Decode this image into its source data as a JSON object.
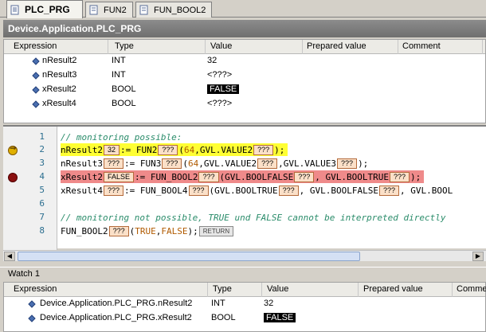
{
  "tabs": [
    {
      "label": "PLC_PRG",
      "active": true
    },
    {
      "label": "FUN2",
      "active": false
    },
    {
      "label": "FUN_BOOL2",
      "active": false
    }
  ],
  "object_title": "Device.Application.PLC_PRG",
  "grid": {
    "columns": [
      "Expression",
      "Type",
      "Value",
      "Prepared value",
      "Comment"
    ],
    "rows": [
      {
        "expr": "nResult2",
        "type": "INT",
        "value": "32"
      },
      {
        "expr": "nResult3",
        "type": "INT",
        "value": "<???>"
      },
      {
        "expr": "xResult2",
        "type": "BOOL",
        "value": "FALSE"
      },
      {
        "expr": "xResult4",
        "type": "BOOL",
        "value": "<???>"
      }
    ]
  },
  "code": {
    "line_numbers": [
      "1",
      "2",
      "3",
      "4",
      "5",
      "6",
      "7",
      "8"
    ],
    "l1": "// monitoring possible:",
    "l2": {
      "a": "nResult2",
      "m1": "32",
      "b": " := FUN2",
      "m2": "???",
      "c": "(",
      "lit": "64",
      "d": ",GVL.VALUE2",
      "m3": "???",
      "e": ");"
    },
    "l3": {
      "a": "nResult3",
      "m1": "???",
      "b": " := FUN3",
      "m2": "???",
      "c": "(",
      "lit": "64",
      "d": ",GVL.VALUE2",
      "m3": "???",
      "e": ",GVL.VALUE3",
      "m4": "???",
      "f": ");"
    },
    "l4": {
      "a": "xResult2",
      "m1": "FALSE",
      "b": " := FUN_BOOL2",
      "m2": "???",
      "c": "(GVL.BOOLFALSE",
      "m3": "???",
      "d": ", GVL.BOOLTRUE",
      "m4": "???",
      "e": ");"
    },
    "l5": {
      "a": "xResult4",
      "m1": "???",
      "b": " := FUN_BOOL4",
      "m2": "???",
      "c": "(GVL.BOOLTRUE",
      "m3": "???",
      "d": ", GVL.BOOLFALSE",
      "m4": "???",
      "e": ", GVL.BOOL"
    },
    "l7": "// monitoring not possible, TRUE und FALSE cannot be interpreted directly",
    "l8": {
      "a": "FUN_BOOL2",
      "m1": "???",
      "b": "(",
      "lit1": "TRUE",
      "c": ", ",
      "lit2": "FALSE",
      "d": ");",
      "m2": "RETURN"
    }
  },
  "watch": {
    "title": "Watch 1",
    "columns": [
      "Expression",
      "Type",
      "Value",
      "Prepared value",
      "Comme"
    ],
    "rows": [
      {
        "expr": "Device.Application.PLC_PRG.nResult2",
        "type": "INT",
        "value": "32"
      },
      {
        "expr": "Device.Application.PLC_PRG.xResult2",
        "type": "BOOL",
        "value": "FALSE"
      }
    ]
  },
  "colors": {
    "highlight_current": "#ffff33",
    "highlight_breakpoint": "#ef8a8a",
    "monitor_box": "#fbe0c8"
  }
}
